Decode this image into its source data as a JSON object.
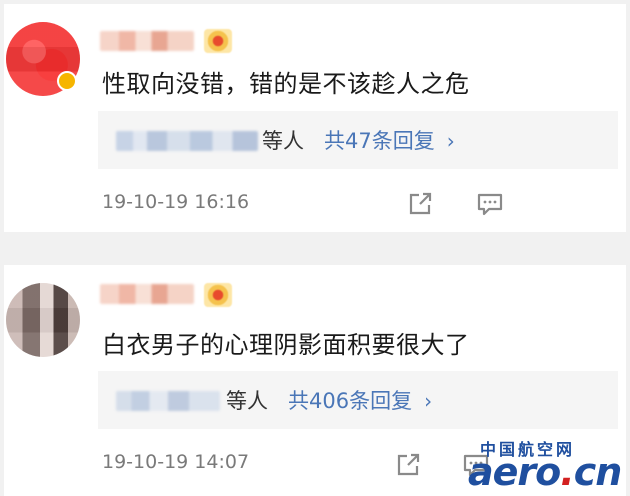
{
  "comments": [
    {
      "text": "性取向没错，错的是不该趁人之危",
      "reply_suffix": "等人",
      "reply_count_text": "共47条回复",
      "timestamp": "19-10-19 16:16"
    },
    {
      "text": "白衣男子的心理阴影面积要很大了",
      "reply_suffix": "等人",
      "reply_count_text": "共406条回复",
      "timestamp": "19-10-19 14:07"
    }
  ],
  "watermark": {
    "site_cn": "中国航空网",
    "logo_main": "aero",
    "logo_dot": ".",
    "logo_tld": "cn"
  },
  "colors": {
    "link_blue": "#4a76b7",
    "text_dark": "#1a1a1a",
    "timestamp_gray": "#7a7a7a",
    "watermark_blue": "#1f4f9f",
    "watermark_red": "#d32020"
  },
  "icons": {
    "share": "share-icon",
    "comment": "comment-icon",
    "chevron": "chevron-right-icon"
  }
}
